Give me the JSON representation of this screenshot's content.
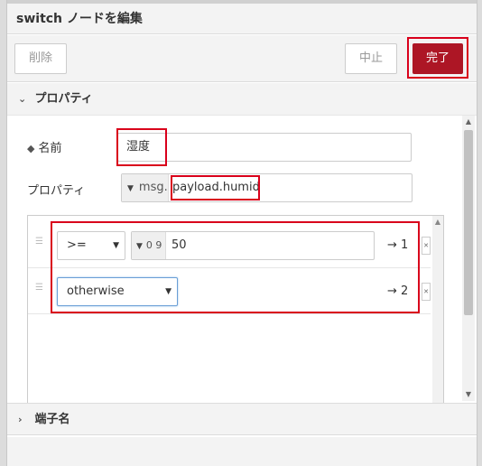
{
  "dialog": {
    "title": "switch ノードを編集"
  },
  "toolbar": {
    "delete_label": "削除",
    "cancel_label": "中止",
    "done_label": "完了"
  },
  "sections": {
    "properties": "プロパティ",
    "port_labels": "端子名"
  },
  "form": {
    "name_label": "名前",
    "name_value": "湿度",
    "property_label": "プロパティ",
    "property_type": "msg.",
    "property_value": "payload.humid"
  },
  "rules": [
    {
      "operator": ">=",
      "value_type_icon": "0 9",
      "value": "50",
      "port": "→ 1"
    },
    {
      "operator": "otherwise",
      "port": "→ 2"
    }
  ],
  "colors": {
    "accent": "#ad1625",
    "highlight": "#d9001b"
  }
}
